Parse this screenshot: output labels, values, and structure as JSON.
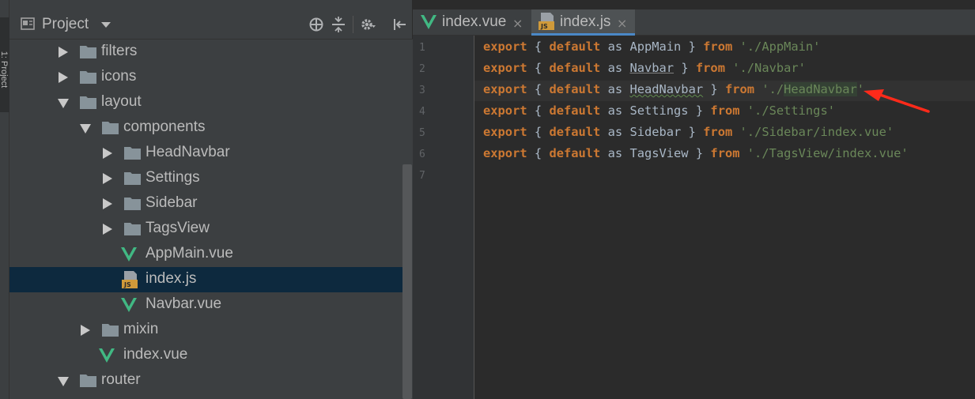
{
  "side_strip": {
    "label": "1: Project"
  },
  "project_panel": {
    "title": "Project",
    "tree": [
      {
        "label": "filters",
        "type": "folder",
        "expanded": false
      },
      {
        "label": "icons",
        "type": "folder",
        "expanded": false
      },
      {
        "label": "layout",
        "type": "folder",
        "expanded": true
      },
      {
        "label": "components",
        "type": "folder",
        "expanded": true
      },
      {
        "label": "HeadNavbar",
        "type": "folder",
        "expanded": false
      },
      {
        "label": "Settings",
        "type": "folder",
        "expanded": false
      },
      {
        "label": "Sidebar",
        "type": "folder",
        "expanded": false
      },
      {
        "label": "TagsView",
        "type": "folder",
        "expanded": false
      },
      {
        "label": "AppMain.vue",
        "type": "vue"
      },
      {
        "label": "index.js",
        "type": "js",
        "selected": true
      },
      {
        "label": "Navbar.vue",
        "type": "vue"
      },
      {
        "label": "mixin",
        "type": "folder",
        "expanded": false
      },
      {
        "label": "index.vue",
        "type": "vue"
      },
      {
        "label": "router",
        "type": "folder",
        "expanded": true
      }
    ]
  },
  "editor": {
    "tabs": [
      {
        "label": "index.vue",
        "icon": "vue-icon",
        "active": false
      },
      {
        "label": "index.js",
        "icon": "js-icon",
        "active": true
      }
    ],
    "close_glyph": "×",
    "line_numbers": [
      "1",
      "2",
      "3",
      "4",
      "5",
      "6",
      "7"
    ],
    "lines": [
      {
        "kw1": "export",
        "open": "{",
        "kw2": "default",
        "as": "as",
        "name": "AppMain",
        "close": "}",
        "kw3": "from",
        "path": "'./AppMain'"
      },
      {
        "kw1": "export",
        "open": "{",
        "kw2": "default",
        "as": "as",
        "name": "Navbar",
        "close": "}",
        "kw3": "from",
        "path": "'./Navbar'"
      },
      {
        "kw1": "export",
        "open": "{",
        "kw2": "default",
        "as": "as",
        "name": "HeadNavbar",
        "close": "}",
        "kw3": "from",
        "path_prefix": "'./",
        "path_hl": "HeadNavbar",
        "path_suffix": "'"
      },
      {
        "kw1": "export",
        "open": "{",
        "kw2": "default",
        "as": "as",
        "name": "Settings",
        "close": "}",
        "kw3": "from",
        "path": "'./Settings'"
      },
      {
        "kw1": "export",
        "open": "{",
        "kw2": "default",
        "as": "as",
        "name": "Sidebar",
        "close": "}",
        "kw3": "from",
        "path": "'./Sidebar/index.vue'"
      },
      {
        "kw1": "export",
        "open": "{",
        "kw2": "default",
        "as": "as",
        "name": "TagsView",
        "close": "}",
        "kw3": "from",
        "path": "'./TagsView/index.vue'"
      }
    ]
  },
  "colors": {
    "background": "#2b2b2b",
    "panel": "#3c3f41",
    "selection": "#0d293e",
    "keyword": "#cc7832",
    "string": "#6a8759",
    "vue_green": "#41b883",
    "annotation_arrow": "#ff2a1a"
  }
}
